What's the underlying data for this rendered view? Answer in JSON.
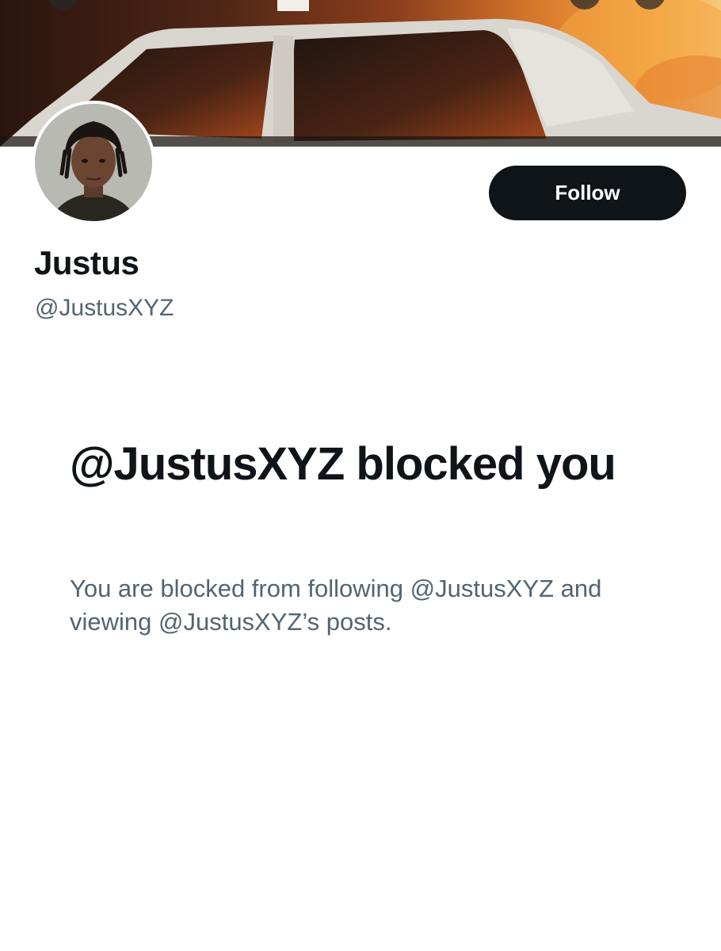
{
  "profile": {
    "display_name": "Justus",
    "handle": "@JustusXYZ",
    "follow_label": "Follow",
    "banner_description": "banner-photo",
    "avatar_description": "profile-photo"
  },
  "blocked": {
    "title": "@JustusXYZ blocked you",
    "description": "You are blocked from following @JustusXYZ and viewing @JustusXYZ’s posts."
  },
  "colors": {
    "primary_text": "#0f1419",
    "secondary_text": "#536471",
    "button_bg": "#0f1419",
    "button_text": "#ffffff",
    "background": "#ffffff"
  },
  "icons": {
    "top_left_control": "back-arrow-icon",
    "top_right_controls": [
      "search-icon",
      "more-icon"
    ]
  }
}
